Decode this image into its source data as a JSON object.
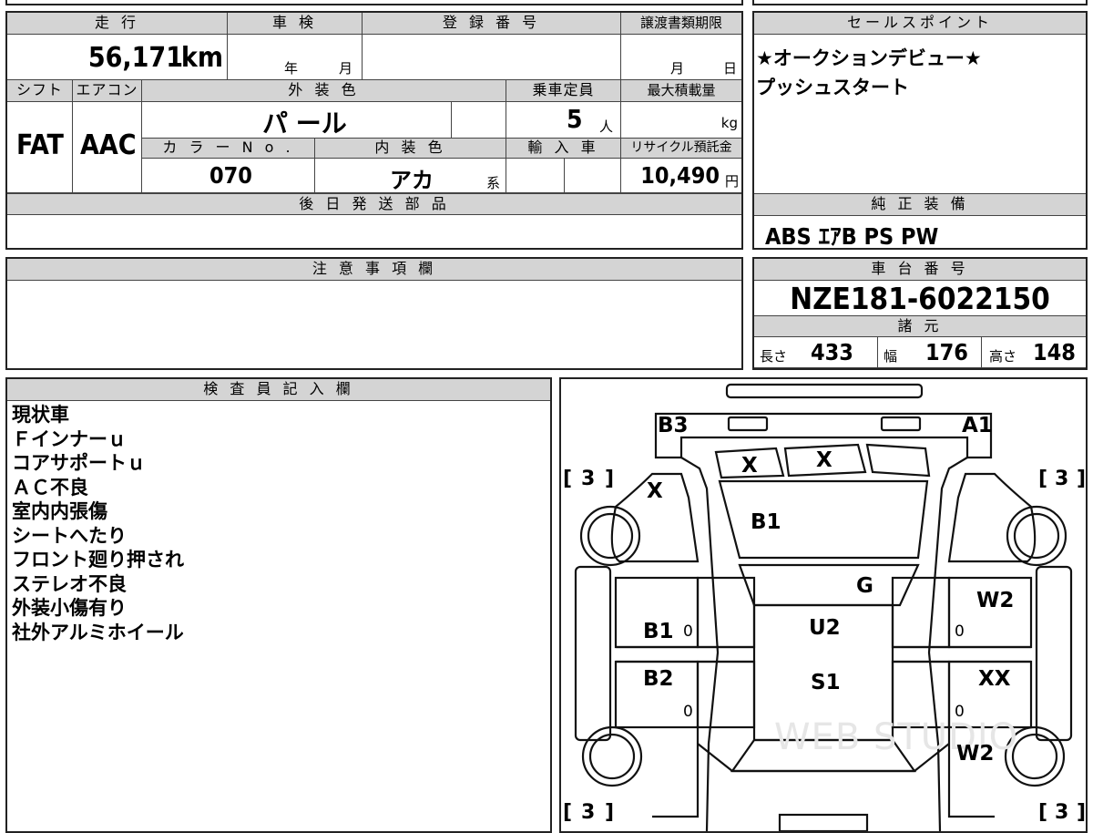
{
  "vehicle": {
    "mileage_header": "走 行",
    "mileage": "56,171",
    "mileage_unit": "km",
    "inspection_header": "車 検",
    "inspection_year_unit": "年",
    "inspection_month_unit": "月",
    "registration_header": "登 録 番 号",
    "transfer_header": "譲渡書類期限",
    "transfer_month_unit": "月",
    "transfer_day_unit": "日",
    "shift_header": "シフト",
    "shift": "FAT",
    "ac_header": "エアコン",
    "ac": "AAC",
    "exterior_color_header": "外 装 色",
    "exterior_color": "パ ール",
    "capacity_header": "乗車定員",
    "capacity": "5",
    "capacity_unit": "人",
    "max_load_header": "最大積載量",
    "max_load_unit": "kg",
    "color_no_header": "カ ラ ー N o .",
    "color_no": "070",
    "interior_color_header": "内 装 色",
    "interior_color": "アカ",
    "interior_suffix": "系",
    "import_header": "輸 入 車",
    "recycle_header": "リサイクル預託金",
    "recycle_fee": "10,490",
    "recycle_unit": "円",
    "parts_header": "後 日 発 送 部 品"
  },
  "sales_point": {
    "header": "セールスポイント",
    "lines": [
      "★オークションデビュー★",
      "プッシュスタート"
    ]
  },
  "equipment": {
    "header": "純 正 装 備",
    "items": "ABS ｴｱB PS PW"
  },
  "notes": {
    "header": "注 意 事 項 欄"
  },
  "chassis": {
    "header": "車 台 番 号",
    "number": "NZE181-6022150"
  },
  "specs": {
    "header": "諸 元",
    "length_label": "長さ",
    "length": "433",
    "width_label": "幅",
    "width": "176",
    "height_label": "高さ",
    "height": "148"
  },
  "inspector": {
    "header": "検 査 員 記 入 欄",
    "lines": [
      "現状車",
      "Ｆインナーｕ",
      "コアサポートｕ",
      "ＡＣ不良",
      "室内内張傷",
      "シートへたり",
      "フロント廻り押され",
      "ステレオ不良",
      "外装小傷有り",
      "社外アルミホイール"
    ]
  },
  "diagram": {
    "codes": {
      "front_left": "B3",
      "front_right": "A1",
      "windshield_left": "X",
      "windshield_right": "X",
      "left_front_fender": "X",
      "hood": "B1",
      "roof": "G",
      "left_front_door": "B1",
      "left_front_door_sub": "0",
      "left_rear_door": "B2",
      "left_rear_door_sub": "0",
      "cabin_front": "U2",
      "cabin_rear": "S1",
      "right_front_door": "W2",
      "right_front_door_sub": "0",
      "right_rear_door": "XX",
      "right_rear_door_sub": "0",
      "right_rear_fender": "W2"
    },
    "tire_tread": {
      "front_left": "3",
      "front_right": "3",
      "rear_left": "3",
      "rear_right": "3"
    }
  },
  "watermark": "WEB STUDIO"
}
